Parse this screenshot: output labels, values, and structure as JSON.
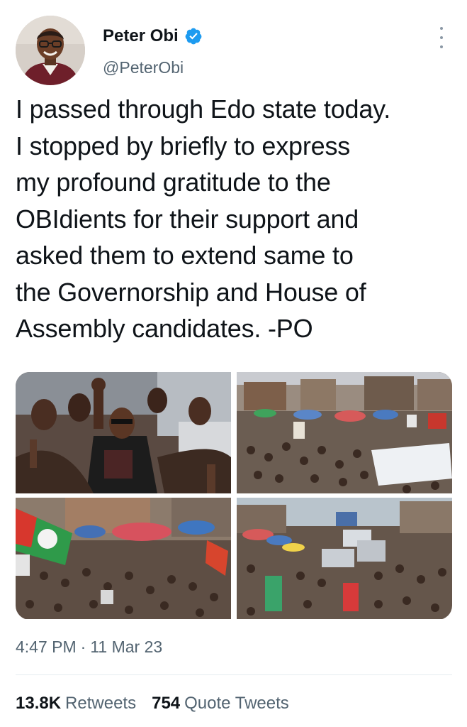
{
  "author": {
    "display_name": "Peter Obi",
    "handle": "@PeterObi",
    "avatar_icon": "profile-photo",
    "verified_icon": "verified-badge-icon",
    "verified_color": "#1d9bf0"
  },
  "tweet": {
    "text": "I passed through Edo state today.\nI stopped by briefly to express\nmy profound gratitude to the\nOBIdients for their support and\nasked them to extend same to\nthe Governorship and House of\nAssembly candidates. -PO"
  },
  "media": {
    "photos": [
      {
        "alt_icon": "rally-photo-closeup"
      },
      {
        "alt_icon": "rally-photo-street-crowd"
      },
      {
        "alt_icon": "rally-photo-market-flags"
      },
      {
        "alt_icon": "rally-photo-convoy-crowd"
      }
    ]
  },
  "meta": {
    "time": "4:47 PM",
    "separator": "·",
    "date": "11 Mar 23"
  },
  "stats": {
    "retweets_count": "13.8K",
    "retweets_label": "Retweets",
    "quotes_count": "754",
    "quotes_label": "Quote Tweets"
  },
  "colors": {
    "text_primary": "#0f1419",
    "text_secondary": "#536471",
    "accent": "#1d9bf0"
  }
}
